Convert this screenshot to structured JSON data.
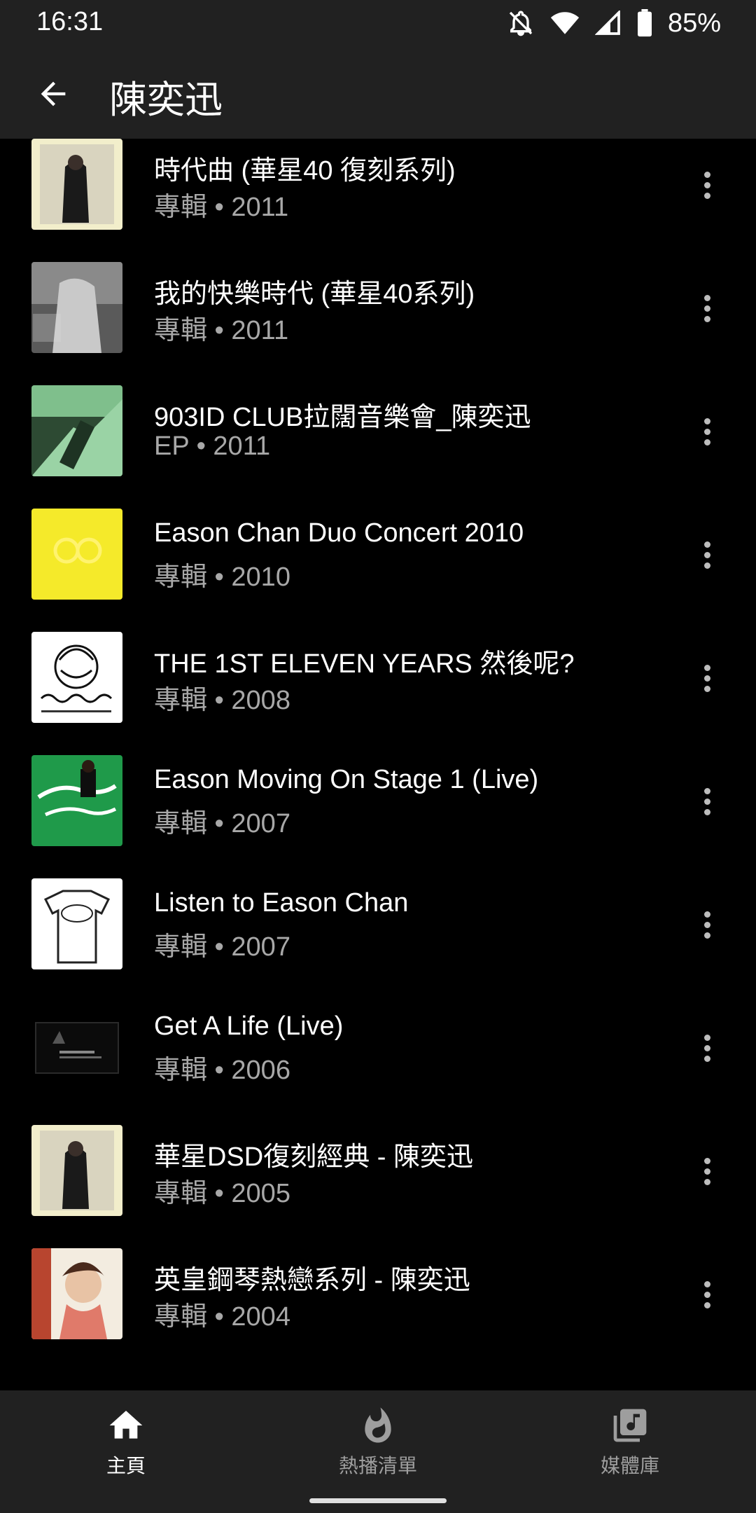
{
  "status_bar": {
    "time": "16:31",
    "battery_percent": "85%",
    "icons": [
      "notifications-off-icon",
      "wifi-icon",
      "cell-signal-icon",
      "battery-icon"
    ]
  },
  "app_bar": {
    "title": "陳奕迅",
    "back_icon": "arrow-back-icon"
  },
  "albums": [
    {
      "title": "時代曲 (華星40 復刻系列)",
      "subtitle": "專輯 • 2011"
    },
    {
      "title": "我的快樂時代 (華星40系列)",
      "subtitle": "專輯 • 2011"
    },
    {
      "title": "903ID CLUB拉闊音樂會_陳奕迅",
      "subtitle": "EP • 2011"
    },
    {
      "title": "Eason Chan Duo Concert 2010",
      "subtitle": "專輯 • 2010"
    },
    {
      "title": "THE 1ST ELEVEN YEARS 然後呢?",
      "subtitle": "專輯 • 2008"
    },
    {
      "title": "Eason Moving On Stage 1 (Live)",
      "subtitle": "專輯 • 2007"
    },
    {
      "title": "Listen to Eason Chan",
      "subtitle": "專輯 • 2007"
    },
    {
      "title": "Get A Life (Live)",
      "subtitle": "專輯 • 2006"
    },
    {
      "title": "華星DSD復刻經典 - 陳奕迅",
      "subtitle": "專輯 • 2005"
    },
    {
      "title": "英皇鋼琴熱戀系列 - 陳奕迅",
      "subtitle": "專輯 • 2004"
    }
  ],
  "bottom_nav": {
    "home": {
      "label": "主頁",
      "icon": "home-icon",
      "active": true
    },
    "hotlist": {
      "label": "熱播清單",
      "icon": "fire-icon",
      "active": false
    },
    "library": {
      "label": "媒體庫",
      "icon": "library-music-icon",
      "active": false
    }
  },
  "colors": {
    "bar_bg": "#212121",
    "page_bg": "#000000",
    "text_primary": "#ffffff",
    "text_secondary": "#a8a8a8"
  }
}
